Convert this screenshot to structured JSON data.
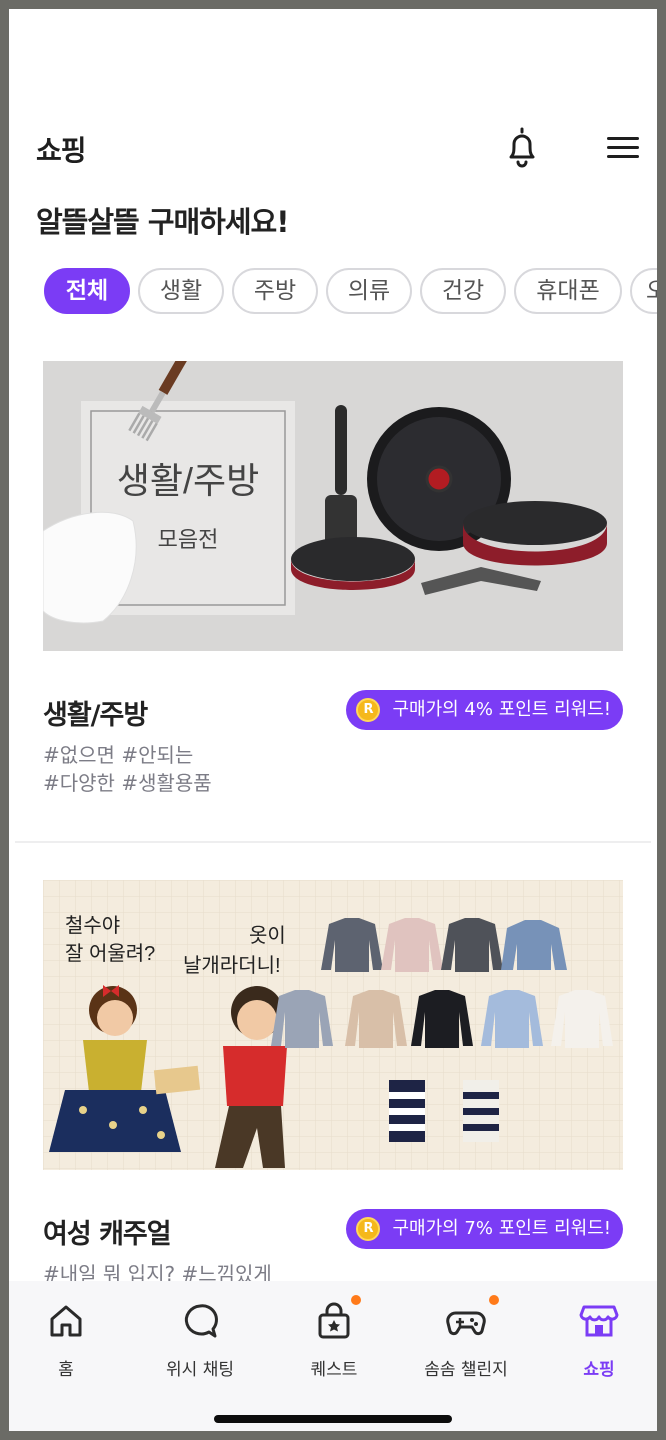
{
  "header": {
    "title": "쇼핑"
  },
  "subtitle": "알뜰살뜰 구매하세요!",
  "categories": [
    "전체",
    "생활",
    "주방",
    "의류",
    "건강",
    "휴대폰",
    "오"
  ],
  "active_category": "전체",
  "cards": [
    {
      "banner_title": "생활/주방",
      "banner_subtitle": "모음전",
      "name": "생활/주방",
      "reward_coin": "R",
      "reward": "구매가의 4% 포인트 리워드!",
      "tags_line1": "#없으면 #안되는",
      "tags_line2": "#다양한 #생활용품"
    },
    {
      "banner_text1_line1": "철수야",
      "banner_text1_line2": "잘 어울려?",
      "banner_text2_line1": "옷이",
      "banner_text2_line2": "날개라더니!",
      "name": "여성 캐주얼",
      "reward_coin": "R",
      "reward": "구매가의 7% 포인트 리워드!",
      "tags_line1": "#내일 뭐 입지? #느낌있게"
    }
  ],
  "bottom_nav": [
    {
      "label": "홈",
      "icon": "home-icon"
    },
    {
      "label": "위시 채팅",
      "icon": "chat-bubble-icon"
    },
    {
      "label": "퀘스트",
      "icon": "quest-bag-icon",
      "badge": true
    },
    {
      "label": "솜솜 챌린지",
      "icon": "gamepad-icon",
      "badge": true
    },
    {
      "label": "쇼핑",
      "icon": "store-icon",
      "active": true
    }
  ],
  "colors": {
    "accent": "#7b3cf5",
    "badge": "#ff7a1a",
    "coin": "#f5b81c"
  }
}
